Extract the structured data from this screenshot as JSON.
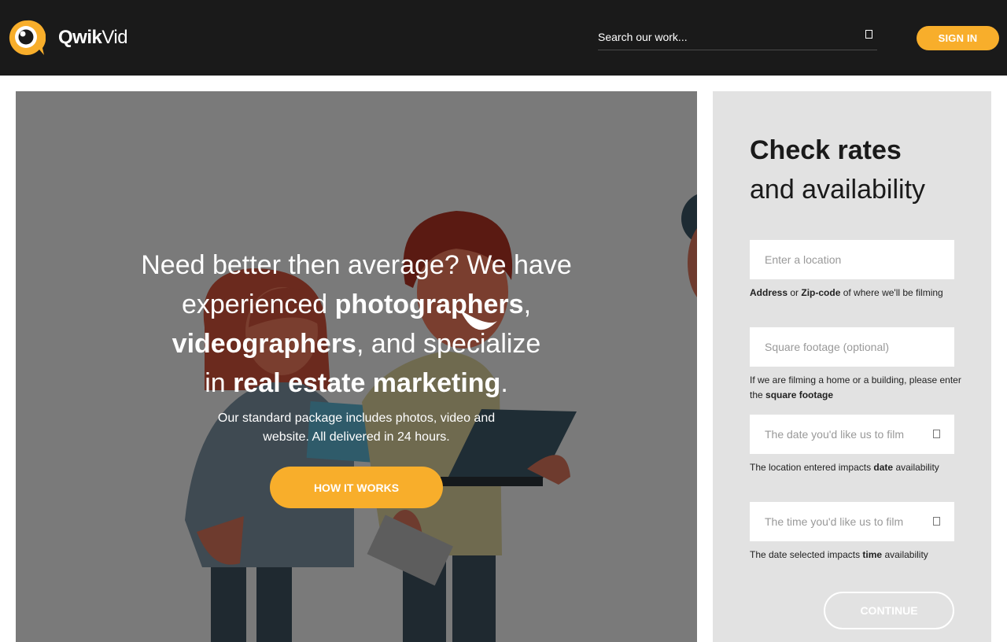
{
  "header": {
    "logo_bold": "Qwik",
    "logo_light": "Vid",
    "search_placeholder": "Search our work...",
    "signin_label": "SIGN IN"
  },
  "hero": {
    "title_1": "Need better then average? We have",
    "title_2a": "experienced ",
    "title_2b": "photographers",
    "title_2c": ",",
    "title_3a": "videographers",
    "title_3b": ", and specialize",
    "title_4a": "in ",
    "title_4b": "real estate marketing",
    "title_4c": ".",
    "subtitle": "Our standard package includes photos, video and website. All delivered in 24 hours.",
    "cta_label": "HOW IT WORKS"
  },
  "form": {
    "heading_bold": "Check rates",
    "heading_light": "and availability",
    "location_placeholder": "Enter a location",
    "location_hint_b1": "Address",
    "location_hint_t1": " or ",
    "location_hint_b2": "Zip-code",
    "location_hint_t2": " of where we'll be filming",
    "sqft_placeholder": "Square footage (optional)",
    "sqft_hint_t1": "If we are filming a home or a building, please enter the ",
    "sqft_hint_b1": "square footage",
    "date_placeholder": "The date you'd like us to film",
    "date_hint_t1": "The location entered impacts ",
    "date_hint_b1": "date",
    "date_hint_t2": " availability",
    "time_placeholder": "The time you'd like us to film",
    "time_hint_t1": "The date selected impacts ",
    "time_hint_b1": "time",
    "time_hint_t2": " availability",
    "continue_label": "CONTINUE"
  },
  "icons": {
    "search": "search-icon",
    "calendar": "calendar-icon",
    "clock": "clock-icon"
  },
  "colors": {
    "header_bg": "#1a1a1a",
    "accent": "#f8ae2b",
    "panel_bg": "#e2e2e2",
    "hero_overlay": "#7a7a7a"
  }
}
